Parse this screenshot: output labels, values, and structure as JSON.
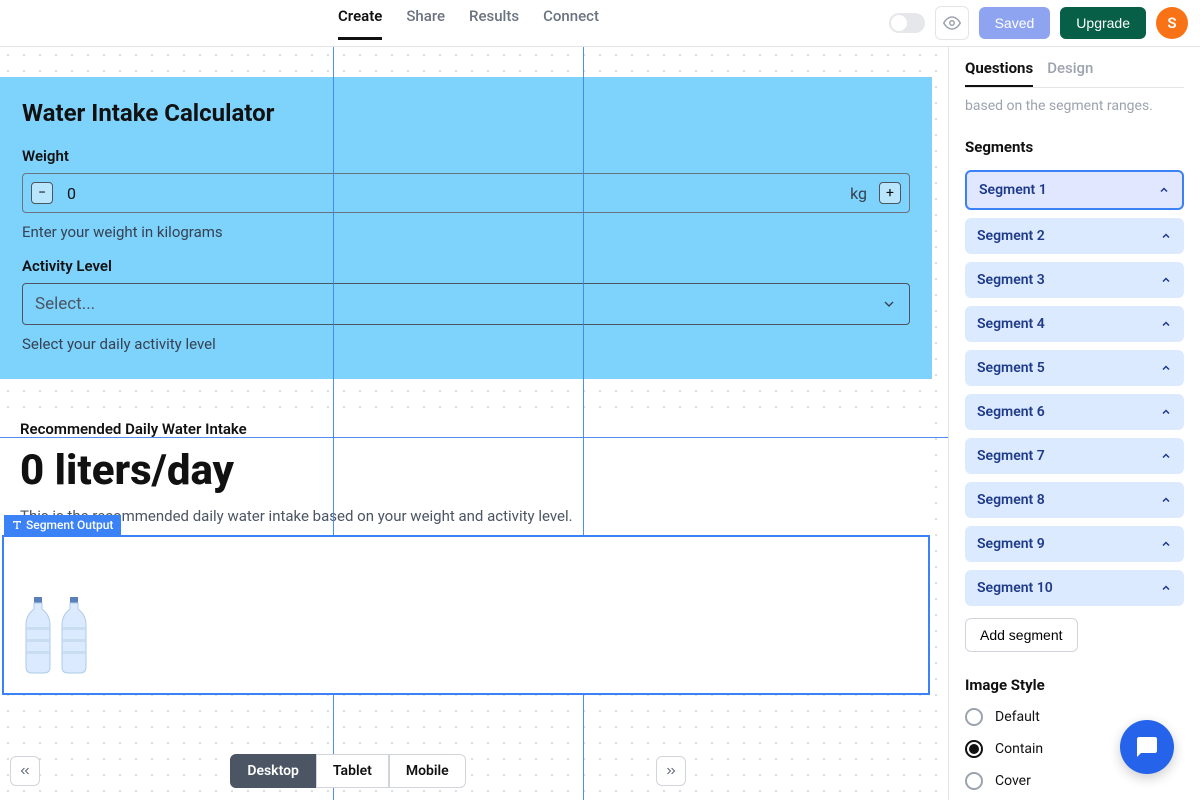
{
  "topbar": {
    "tabs": [
      "Create",
      "Share",
      "Results",
      "Connect"
    ],
    "active_tab": 0,
    "saved_label": "Saved",
    "upgrade_label": "Upgrade",
    "avatar_initial": "S"
  },
  "canvas": {
    "form": {
      "title": "Water Intake Calculator",
      "weight": {
        "label": "Weight",
        "value": "0",
        "unit": "kg",
        "helper": "Enter your weight in kilograms"
      },
      "activity": {
        "label": "Activity Level",
        "placeholder": "Select...",
        "helper": "Select your daily activity level"
      }
    },
    "result": {
      "label": "Recommended Daily Water Intake",
      "value": "0 liters/day",
      "description": "This is the recommended daily water intake based on your weight and activity level."
    },
    "segment_output_tag": "Segment Output"
  },
  "sidebar": {
    "tabs": [
      "Questions",
      "Design"
    ],
    "active_tab": 0,
    "helper_text": "based on the segment ranges.",
    "segments_title": "Segments",
    "segments": [
      "Segment 1",
      "Segment 2",
      "Segment 3",
      "Segment 4",
      "Segment 5",
      "Segment 6",
      "Segment 7",
      "Segment 8",
      "Segment 9",
      "Segment 10"
    ],
    "selected_segment": 0,
    "add_segment_label": "Add segment",
    "image_style": {
      "title": "Image Style",
      "options": [
        "Default",
        "Contain",
        "Cover"
      ],
      "selected": 1
    }
  },
  "footer": {
    "devices": [
      "Desktop",
      "Tablet",
      "Mobile"
    ],
    "active_device": 0
  }
}
